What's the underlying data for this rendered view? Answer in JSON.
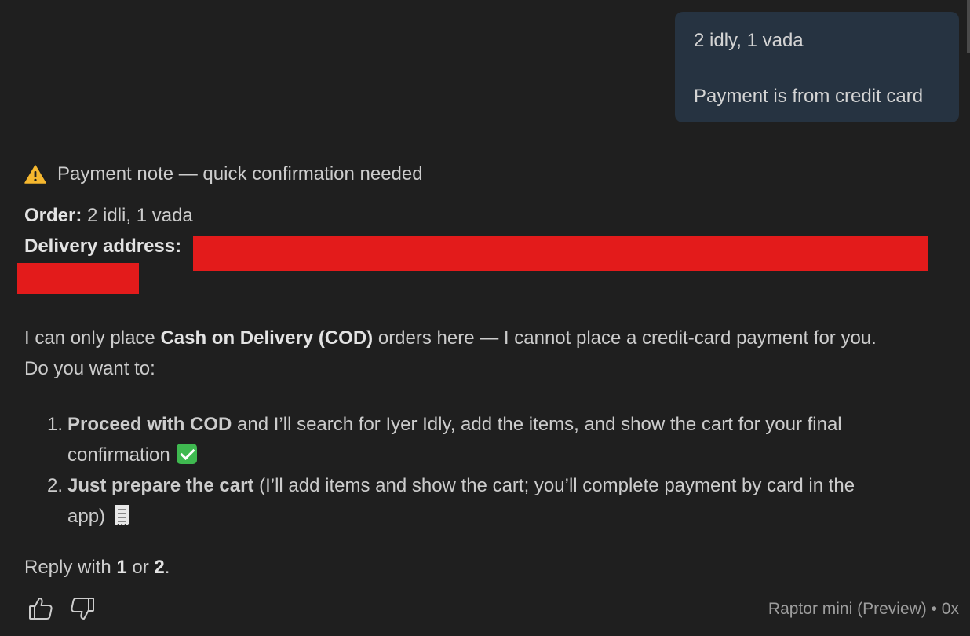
{
  "user_message": {
    "line1": "2 idly, 1 vada",
    "line2": "Payment is from credit card"
  },
  "response": {
    "heading_icon": "warning-icon",
    "heading": "Payment note — quick confirmation needed",
    "order_label": "Order:",
    "order_value": " 2 idli, 1 vada",
    "address_label": "Delivery address:",
    "para1_pre": "I can only place ",
    "para1_bold": "Cash on Delivery (COD)",
    "para1_post": " orders here — I cannot place a credit-card payment for you.",
    "para2": "Do you want to:",
    "options": [
      {
        "num": "1.",
        "bold": "Proceed with COD",
        "text_a": " and I’ll search for Iyer Idly, add the items, and show the cart for your final",
        "text_b": "confirmation",
        "emoji": "check-mark-icon"
      },
      {
        "num": "2.",
        "bold": "Just prepare the cart",
        "text_a": " (I’ll add items and show the cart; you’ll complete payment by card in the",
        "text_b": "app)",
        "emoji": "receipt-icon"
      }
    ],
    "reply_pre": "Reply with ",
    "reply_opt1": "1",
    "reply_mid": " or ",
    "reply_opt2": "2",
    "reply_post": "."
  },
  "footer": {
    "thumbs_up_icon": "thumbs-up-icon",
    "thumbs_down_icon": "thumbs-down-icon",
    "model_label": "Raptor mini (Preview) • 0x"
  },
  "colors": {
    "background": "#1f1f1f",
    "user_bubble": "#263341",
    "redaction": "#e31b1b",
    "text": "#cccccc",
    "muted_text": "#9d9d9d"
  }
}
